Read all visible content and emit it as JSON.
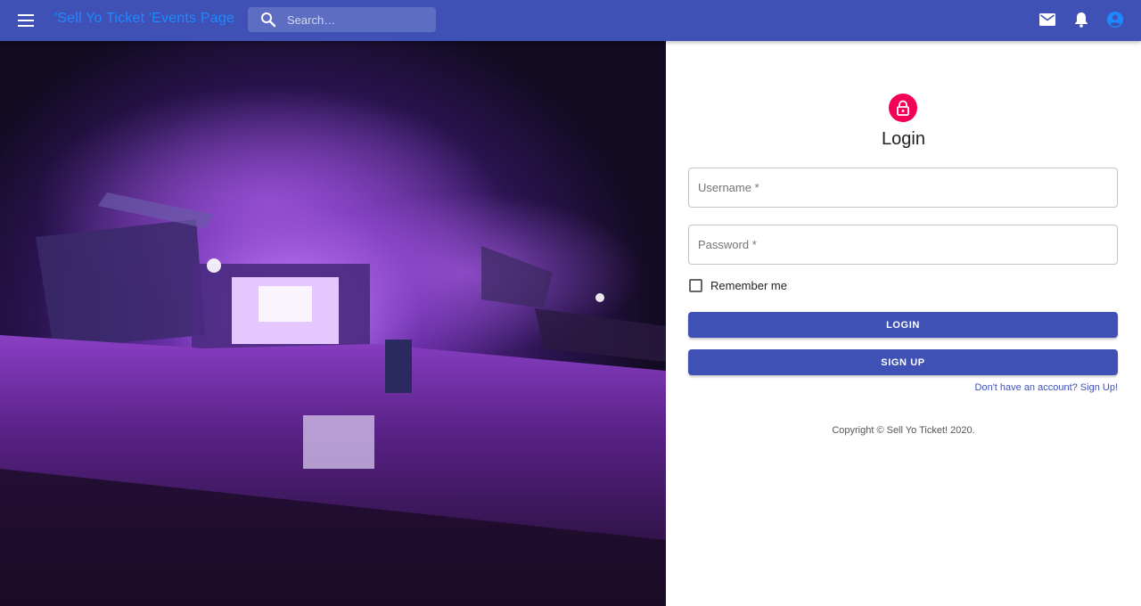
{
  "appbar": {
    "brand": "'Sell Yo Ticket 'Events Page",
    "search_placeholder": "Search…",
    "icons": [
      "menu-icon",
      "search-icon",
      "mail-icon",
      "bell-icon",
      "account-icon"
    ]
  },
  "login": {
    "title": "Login",
    "username_placeholder": "Username *",
    "password_placeholder": "Password *",
    "remember_label": "Remember me",
    "login_button": "LOGIN",
    "signup_button": "SIGN UP",
    "signup_link": "Don't have an account? Sign Up!",
    "copyright": "Copyright © Sell Yo Ticket! 2020."
  },
  "colors": {
    "primary": "#3f51b5",
    "secondary": "#f50057",
    "brand_text": "#1e88ff"
  }
}
